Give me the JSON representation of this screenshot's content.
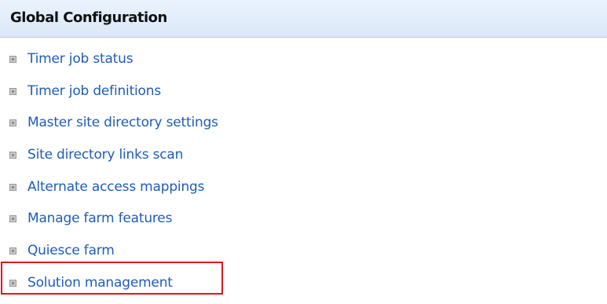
{
  "section": {
    "title": "Global Configuration"
  },
  "links": [
    {
      "label": "Timer job status",
      "bullet_icon": "square-bullet-icon"
    },
    {
      "label": "Timer job definitions",
      "bullet_icon": "square-bullet-icon"
    },
    {
      "label": "Master site directory settings",
      "bullet_icon": "square-bullet-icon"
    },
    {
      "label": "Site directory links scan",
      "bullet_icon": "square-bullet-icon"
    },
    {
      "label": "Alternate access mappings",
      "bullet_icon": "square-bullet-icon"
    },
    {
      "label": "Manage farm features",
      "bullet_icon": "square-bullet-icon"
    },
    {
      "label": "Quiesce farm",
      "bullet_icon": "square-bullet-icon"
    },
    {
      "label": "Solution management",
      "bullet_icon": "square-bullet-icon"
    }
  ],
  "highlight": {
    "target": "Solution management",
    "color": "#e0161f"
  },
  "colors": {
    "header_background": "#dbe8f8",
    "link": "#1f5cb8",
    "title": "#111111"
  }
}
